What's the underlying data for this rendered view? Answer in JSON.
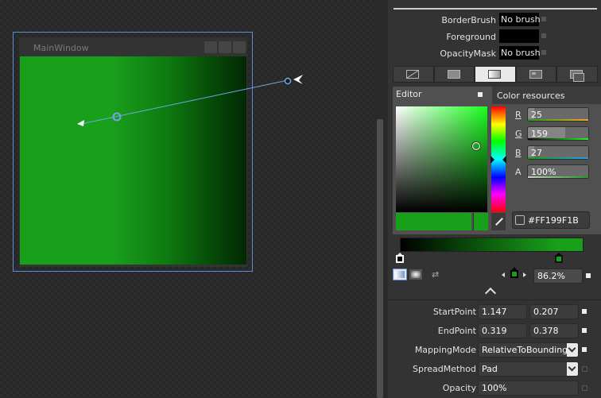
{
  "artboard": {
    "window_title": "MainWindow"
  },
  "brush_props": [
    {
      "label": "BorderBrush",
      "value": "No brush"
    },
    {
      "label": "Foreground",
      "value": ""
    },
    {
      "label": "OpacityMask",
      "value": "No brush"
    }
  ],
  "brush_tabs": [
    "null-brush-icon",
    "solid-brush-icon",
    "gradient-brush-icon",
    "tile-brush-icon",
    "brush-resources-icon"
  ],
  "editor": {
    "tab_label": "Editor",
    "resources_tab_label": "Color resources",
    "channels": [
      {
        "key": "R",
        "value": "25"
      },
      {
        "key": "G",
        "value": "159"
      },
      {
        "key": "B",
        "value": "27"
      },
      {
        "key": "A",
        "value": "100%"
      }
    ],
    "hex": "#FF199F1B",
    "color": "#19a01b"
  },
  "gradient": {
    "stops": [
      {
        "color": "#000000",
        "offset": 0
      },
      {
        "color": "#19a01b",
        "offset": 0.862
      }
    ],
    "selected_offset": "86.2%"
  },
  "props": {
    "start_point": {
      "label": "StartPoint",
      "x": "1.147",
      "y": "0.207"
    },
    "end_point": {
      "label": "EndPoint",
      "x": "0.319",
      "y": "0.378"
    },
    "mapping_mode": {
      "label": "MappingMode",
      "value": "RelativeToBoundingI"
    },
    "spread_method": {
      "label": "SpreadMethod",
      "value": "Pad"
    },
    "opacity": {
      "label": "Opacity",
      "value": "100%"
    }
  }
}
